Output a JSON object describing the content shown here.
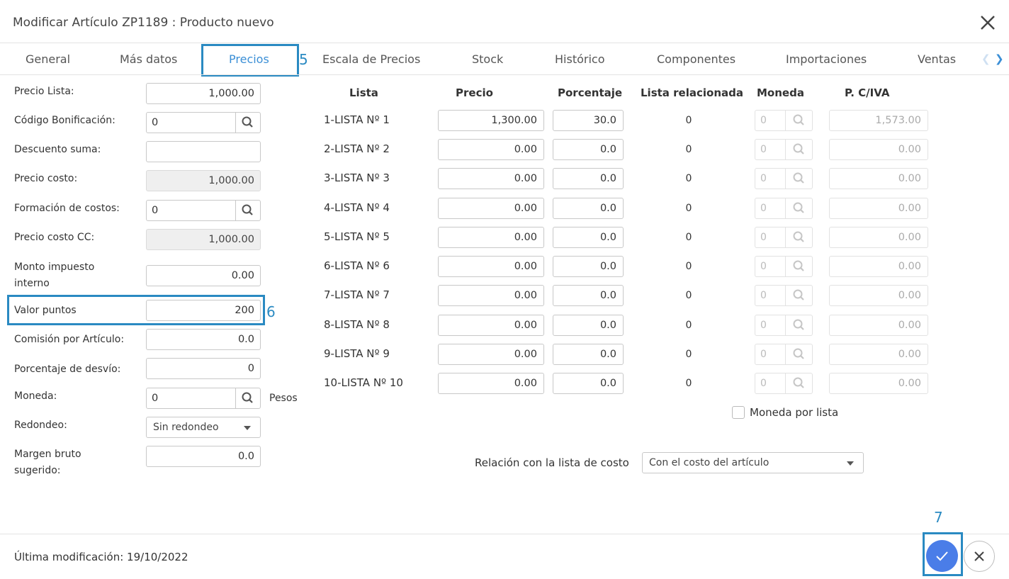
{
  "dialog": {
    "title": "Modificar Artículo ZP1189 : Producto nuevo"
  },
  "tabs": [
    {
      "label": "General"
    },
    {
      "label": "Más datos"
    },
    {
      "label": "Precios",
      "active": true
    },
    {
      "label": "Escala de Precios"
    },
    {
      "label": "Stock"
    },
    {
      "label": "Histórico"
    },
    {
      "label": "Componentes"
    },
    {
      "label": "Importaciones"
    },
    {
      "label": "Ventas"
    }
  ],
  "annotations": {
    "tab": "5",
    "field": "6",
    "button": "7"
  },
  "form": {
    "precio_lista": {
      "label": "Precio Lista:",
      "value": "1,000.00"
    },
    "codigo_bonificacion": {
      "label": "Código Bonificación:",
      "value": "0"
    },
    "descuento_suma": {
      "label": "Descuento suma:",
      "value": ""
    },
    "precio_costo": {
      "label": "Precio costo:",
      "value": "1,000.00"
    },
    "formacion_costos": {
      "label": "Formación de costos:",
      "value": "0"
    },
    "precio_costo_cc": {
      "label": "Precio costo CC:",
      "value": "1,000.00"
    },
    "monto_impuesto": {
      "label_1": "Monto impuesto",
      "label_2": "interno",
      "value": "0.00"
    },
    "valor_puntos": {
      "label": "Valor puntos",
      "value": "200"
    },
    "comision": {
      "label": "Comisión por Artículo:",
      "value": "0.0"
    },
    "porcentaje_desvio": {
      "label": "Porcentaje de desvío:",
      "value": "0"
    },
    "moneda": {
      "label": "Moneda:",
      "value": "0",
      "desc": "Pesos"
    },
    "redondeo": {
      "label": "Redondeo:",
      "value": "Sin redondeo"
    },
    "margen": {
      "label_1": "Margen bruto",
      "label_2": "sugerido:",
      "value": "0.0"
    }
  },
  "price_table": {
    "headers": {
      "lista": "Lista",
      "precio": "Precio",
      "porcentaje": "Porcentaje",
      "relacionada": "Lista relacionada",
      "moneda": "Moneda",
      "pciva": "P. C/IVA"
    },
    "rows": [
      {
        "name": "1-LISTA Nº 1",
        "precio": "1,300.00",
        "porcentaje": "30.0",
        "relacionada": "0",
        "moneda": "0",
        "pciva": "1,573.00"
      },
      {
        "name": "2-LISTA Nº 2",
        "precio": "0.00",
        "porcentaje": "0.0",
        "relacionada": "0",
        "moneda": "0",
        "pciva": "0.00"
      },
      {
        "name": "3-LISTA Nº 3",
        "precio": "0.00",
        "porcentaje": "0.0",
        "relacionada": "0",
        "moneda": "0",
        "pciva": "0.00"
      },
      {
        "name": "4-LISTA Nº 4",
        "precio": "0.00",
        "porcentaje": "0.0",
        "relacionada": "0",
        "moneda": "0",
        "pciva": "0.00"
      },
      {
        "name": "5-LISTA Nº 5",
        "precio": "0.00",
        "porcentaje": "0.0",
        "relacionada": "0",
        "moneda": "0",
        "pciva": "0.00"
      },
      {
        "name": "6-LISTA Nº 6",
        "precio": "0.00",
        "porcentaje": "0.0",
        "relacionada": "0",
        "moneda": "0",
        "pciva": "0.00"
      },
      {
        "name": "7-LISTA Nº 7",
        "precio": "0.00",
        "porcentaje": "0.0",
        "relacionada": "0",
        "moneda": "0",
        "pciva": "0.00"
      },
      {
        "name": "8-LISTA Nº 8",
        "precio": "0.00",
        "porcentaje": "0.0",
        "relacionada": "0",
        "moneda": "0",
        "pciva": "0.00"
      },
      {
        "name": "9-LISTA Nº 9",
        "precio": "0.00",
        "porcentaje": "0.0",
        "relacionada": "0",
        "moneda": "0",
        "pciva": "0.00"
      },
      {
        "name": "10-LISTA Nº 10",
        "precio": "0.00",
        "porcentaje": "0.0",
        "relacionada": "0",
        "moneda": "0",
        "pciva": "0.00"
      }
    ],
    "moneda_por_lista": "Moneda por lista",
    "relacion_label": "Relación con la lista de costo",
    "relacion_value": "Con el costo del artículo"
  },
  "footer": {
    "last_modified": "Última modificación: 19/10/2022"
  },
  "colors": {
    "accent": "#3b8fd6",
    "highlight": "#2a8ac2",
    "ok_button": "#4a7de8"
  }
}
